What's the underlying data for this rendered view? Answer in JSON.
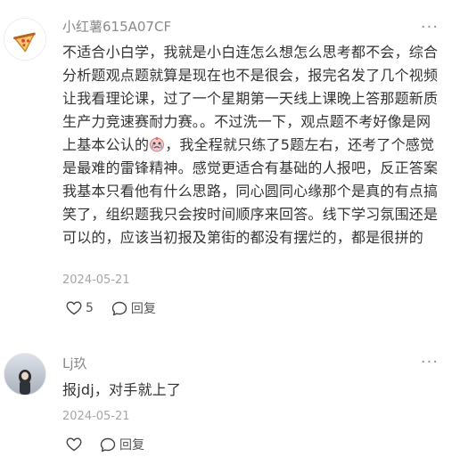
{
  "comments": [
    {
      "username": "小红薯615A07CF",
      "avatar_icon": "pizza-slice-icon",
      "content_part1": "不适合小白学，我就是小白连怎么想怎么思考都不会，综合分析题观点题就算是现在也不是很会，报完名发了几个视频让我看理论课，过了一个星期第一天线上课晚上答那题新质生产力竞速赛耐力赛。。不过洗一下，观点题不考好像是网上基本公认的",
      "content_emoji": "crying-face-icon",
      "content_part2": "，我全程就只练了5题左右，还考了个感觉是最难的雷锋精神。感觉更适合有基础的人报吧，反正答案我基本只看他有什么思路，同心圆同心缘那个是真的有点搞笑了，组织题我只会按时间顺序来回答。线下学习氛围还是可以的，应该当初报及第街的都没有摆烂的，都是很拼的",
      "date": "2024-05-21",
      "likes": "5",
      "reply_label": "回复"
    },
    {
      "username": "Lj玖",
      "content": "报jdj，对手就上了",
      "date": "2024-05-21",
      "likes": "",
      "reply_label": "回复"
    }
  ],
  "more_label": "···"
}
